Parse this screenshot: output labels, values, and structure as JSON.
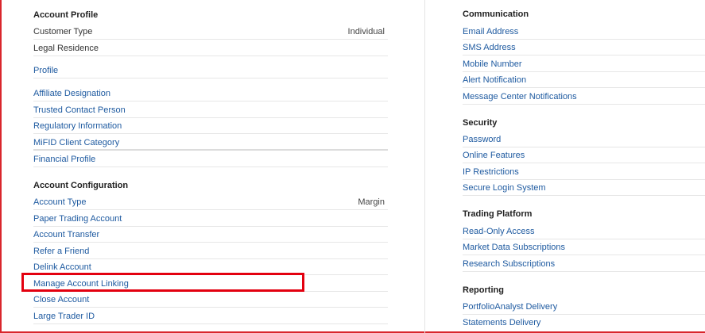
{
  "left": {
    "account_profile": {
      "title": "Account Profile",
      "items": [
        {
          "label": "Customer Type",
          "value": "Individual"
        },
        {
          "label": "Legal Residence"
        },
        {
          "label": "Profile"
        },
        {
          "label": "Affiliate Designation"
        },
        {
          "label": "Trusted Contact Person"
        },
        {
          "label": "Regulatory Information"
        },
        {
          "label": "MiFID Client Category"
        },
        {
          "label": "Financial Profile"
        }
      ]
    },
    "account_configuration": {
      "title": "Account Configuration",
      "items": [
        {
          "label": "Account Type",
          "value": "Margin"
        },
        {
          "label": "Paper Trading Account"
        },
        {
          "label": "Account Transfer"
        },
        {
          "label": "Refer a Friend"
        },
        {
          "label": "Delink Account"
        },
        {
          "label": "Manage Account Linking"
        },
        {
          "label": "Close Account"
        },
        {
          "label": "Large Trader ID"
        }
      ]
    }
  },
  "right": {
    "communication": {
      "title": "Communication",
      "items": [
        {
          "label": "Email Address"
        },
        {
          "label": "SMS Address"
        },
        {
          "label": "Mobile Number"
        },
        {
          "label": "Alert Notification"
        },
        {
          "label": "Message Center Notifications"
        }
      ]
    },
    "security": {
      "title": "Security",
      "items": [
        {
          "label": "Password"
        },
        {
          "label": "Online Features"
        },
        {
          "label": "IP Restrictions"
        },
        {
          "label": "Secure Login System"
        }
      ]
    },
    "trading_platform": {
      "title": "Trading Platform",
      "items": [
        {
          "label": "Read-Only Access"
        },
        {
          "label": "Market Data Subscriptions"
        },
        {
          "label": "Research Subscriptions"
        }
      ]
    },
    "reporting": {
      "title": "Reporting",
      "items": [
        {
          "label": "PortfolioAnalyst Delivery"
        },
        {
          "label": "Statements Delivery"
        }
      ]
    }
  },
  "colors": {
    "link": "#1e5aa0",
    "frame": "#d9262c",
    "highlight": "#e3000f"
  }
}
